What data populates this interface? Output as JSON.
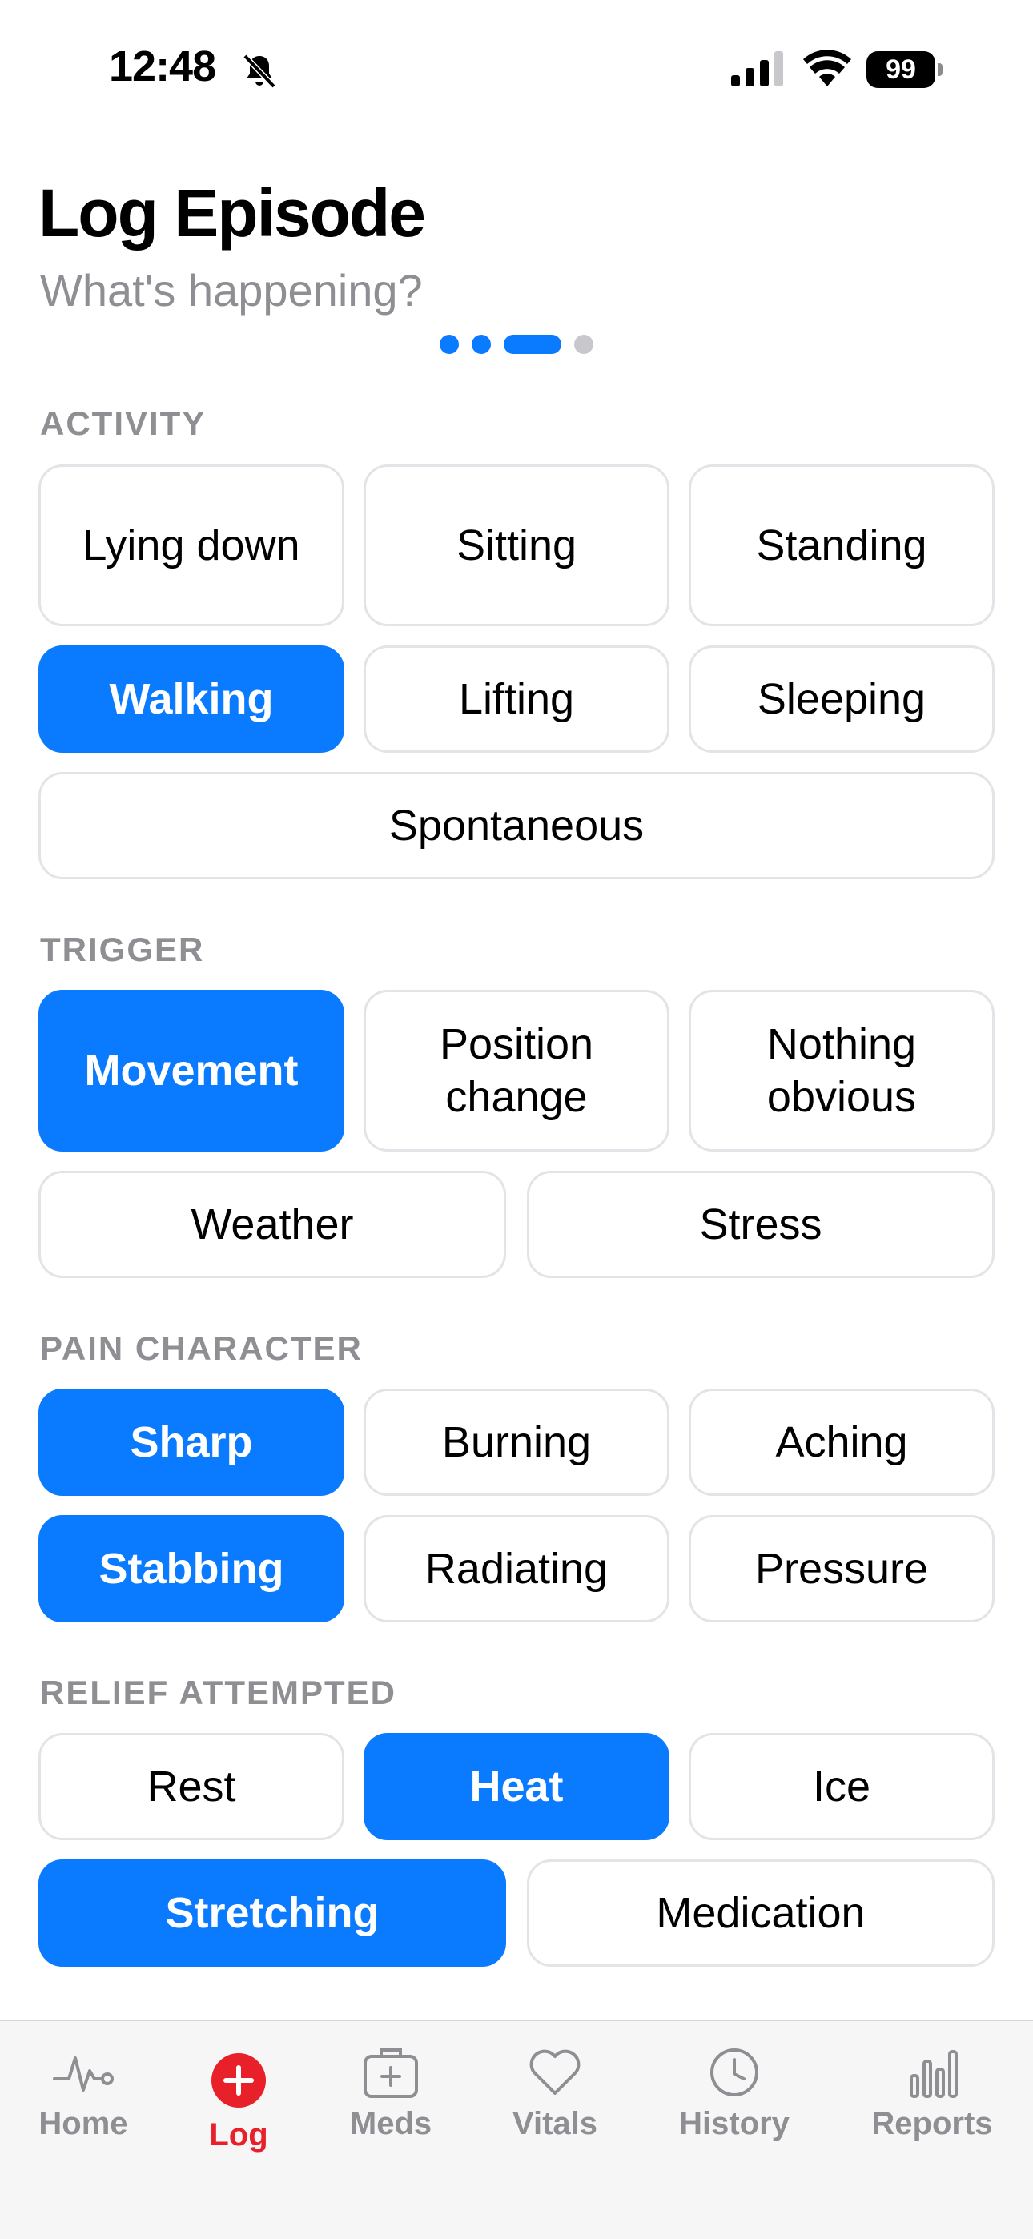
{
  "status_bar": {
    "time": "12:48",
    "battery": "99"
  },
  "header": {
    "title": "Log Episode",
    "subtitle": "What's happening?",
    "steps": [
      {
        "state": "done"
      },
      {
        "state": "done"
      },
      {
        "state": "current"
      },
      {
        "state": "pending"
      }
    ]
  },
  "sections": {
    "activity": {
      "label": "ACTIVITY",
      "options": [
        {
          "label": "Lying down",
          "selected": false
        },
        {
          "label": "Sitting",
          "selected": false
        },
        {
          "label": "Standing",
          "selected": false
        },
        {
          "label": "Walking",
          "selected": true
        },
        {
          "label": "Lifting",
          "selected": false
        },
        {
          "label": "Sleeping",
          "selected": false
        },
        {
          "label": "Spontaneous",
          "selected": false
        }
      ]
    },
    "trigger": {
      "label": "TRIGGER",
      "options": [
        {
          "label": "Movement",
          "selected": true
        },
        {
          "label": "Position change",
          "selected": false
        },
        {
          "label": "Nothing obvious",
          "selected": false
        },
        {
          "label": "Weather",
          "selected": false
        },
        {
          "label": "Stress",
          "selected": false
        }
      ]
    },
    "pain_character": {
      "label": "PAIN CHARACTER",
      "options": [
        {
          "label": "Sharp",
          "selected": true
        },
        {
          "label": "Burning",
          "selected": false
        },
        {
          "label": "Aching",
          "selected": false
        },
        {
          "label": "Stabbing",
          "selected": true
        },
        {
          "label": "Radiating",
          "selected": false
        },
        {
          "label": "Pressure",
          "selected": false
        }
      ]
    },
    "relief": {
      "label": "RELIEF ATTEMPTED",
      "options": [
        {
          "label": "Rest",
          "selected": false
        },
        {
          "label": "Heat",
          "selected": true
        },
        {
          "label": "Ice",
          "selected": false
        },
        {
          "label": "Stretching",
          "selected": true
        },
        {
          "label": "Medication",
          "selected": false
        }
      ]
    }
  },
  "tab_bar": {
    "tabs": [
      {
        "label": "Home",
        "icon": "heartbeat-icon",
        "active": false
      },
      {
        "label": "Log",
        "icon": "plus-circle-icon",
        "active": true
      },
      {
        "label": "Meds",
        "icon": "medkit-icon",
        "active": false
      },
      {
        "label": "Vitals",
        "icon": "heart-icon",
        "active": false
      },
      {
        "label": "History",
        "icon": "clock-icon",
        "active": false
      },
      {
        "label": "Reports",
        "icon": "bar-chart-icon",
        "active": false
      }
    ]
  },
  "colors": {
    "accent": "#0a7bff",
    "active_tab": "#e8202a",
    "muted_text": "#8e8e93",
    "chip_border": "#e3e3e8"
  }
}
